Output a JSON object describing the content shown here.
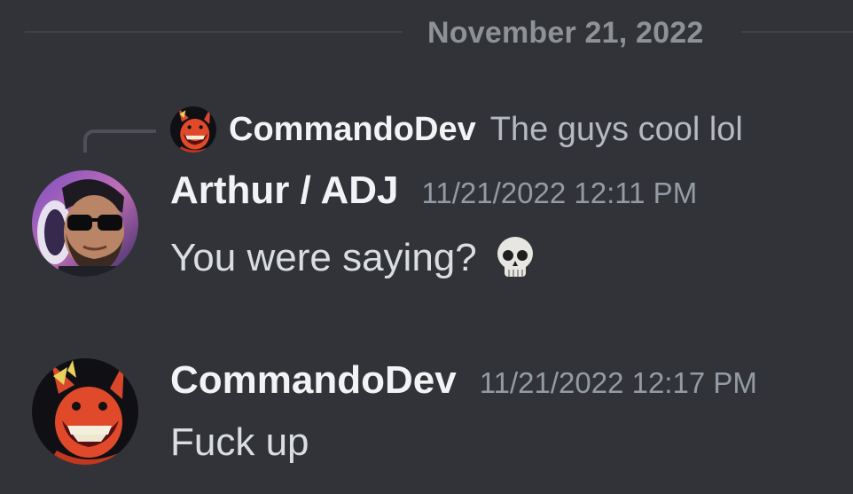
{
  "divider": {
    "date": "November 21, 2022"
  },
  "reply": {
    "author": "CommandoDev",
    "text": "The guys cool lol",
    "avatar_icon": "demon-avatar-icon"
  },
  "messages": [
    {
      "author": "Arthur / ADJ",
      "timestamp": "11/21/2022 12:11 PM",
      "content": "You were saying?",
      "emoji_icon": "skull-emoji-icon",
      "avatar_icon": "man-sunglasses-avatar-icon"
    },
    {
      "author": "CommandoDev",
      "timestamp": "11/21/2022 12:17 PM",
      "content": "Fuck up",
      "avatar_icon": "demon-avatar-icon"
    }
  ],
  "colors": {
    "background": "#313338",
    "username": "#f2f3f5",
    "timestamp": "#949ba4",
    "divider_text": "#8e9297",
    "reply_text": "#b5bac1"
  }
}
